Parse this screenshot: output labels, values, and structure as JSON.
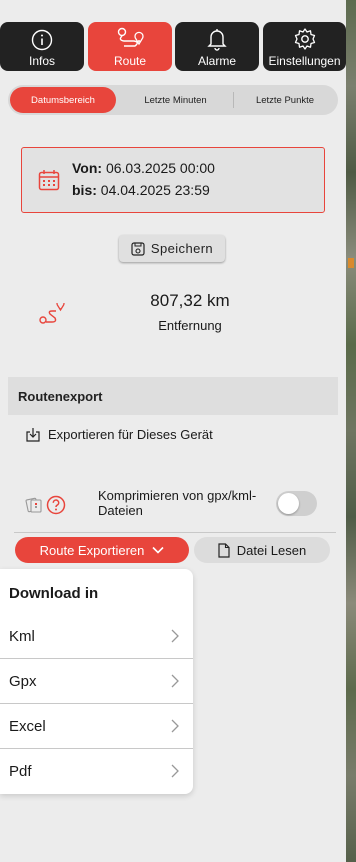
{
  "colors": {
    "accent": "#e8453c",
    "dark_tab": "#222222"
  },
  "tabs": [
    {
      "label": "Infos",
      "icon": "info-icon",
      "active": false
    },
    {
      "label": "Route",
      "icon": "route-icon",
      "active": true
    },
    {
      "label": "Alarme",
      "icon": "bell-icon",
      "active": false
    },
    {
      "label": "Einstellungen",
      "icon": "gear-icon",
      "active": false
    }
  ],
  "segments": [
    {
      "label": "Datumsbereich",
      "active": true
    },
    {
      "label": "Letzte Minuten",
      "active": false
    },
    {
      "label": "Letzte Punkte",
      "active": false
    }
  ],
  "date_range": {
    "from_label": "Von:",
    "from_value": "06.03.2025 00:00",
    "to_label": "bis:",
    "to_value": "04.04.2025 23:59"
  },
  "save_label": "Speichern",
  "distance": {
    "value": "807,32 km",
    "label": "Entfernung"
  },
  "route_export": {
    "section_title": "Routenexport",
    "export_device_label": "Exportieren für Dieses Gerät",
    "compress_label": "Komprimieren von gpx/kml-Dateien",
    "compress_on": false,
    "export_button": "Route Exportieren",
    "read_file_button": "Datei Lesen"
  },
  "download_menu": {
    "title": "Download in",
    "items": [
      "Kml",
      "Gpx",
      "Excel",
      "Pdf"
    ]
  }
}
